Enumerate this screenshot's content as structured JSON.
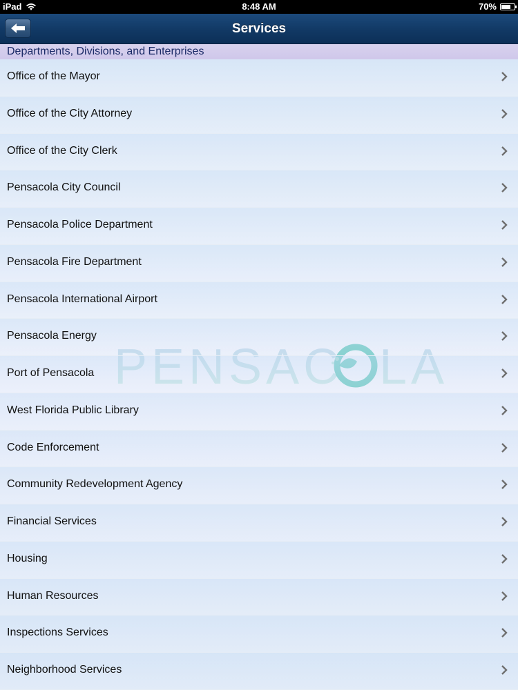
{
  "status_bar": {
    "device": "iPad",
    "time": "8:48 AM",
    "battery": "70%",
    "battery_level": 0.7
  },
  "nav": {
    "title": "Services",
    "back_icon": "back-arrow-icon"
  },
  "section": {
    "header": "Departments, Divisions, and Enterprises"
  },
  "watermark": {
    "text": "PENSACOLA"
  },
  "items": [
    {
      "label": "Office of the Mayor"
    },
    {
      "label": "Office of the City Attorney"
    },
    {
      "label": "Office of the City Clerk"
    },
    {
      "label": "Pensacola City Council"
    },
    {
      "label": "Pensacola Police Department"
    },
    {
      "label": "Pensacola Fire Department"
    },
    {
      "label": "Pensacola International Airport"
    },
    {
      "label": "Pensacola Energy"
    },
    {
      "label": "Port of Pensacola"
    },
    {
      "label": "West Florida Public Library"
    },
    {
      "label": "Code Enforcement"
    },
    {
      "label": "Community Redevelopment Agency"
    },
    {
      "label": "Financial Services"
    },
    {
      "label": "Housing"
    },
    {
      "label": "Human Resources"
    },
    {
      "label": "Inspections Services"
    },
    {
      "label": "Neighborhood Services"
    }
  ],
  "colors": {
    "nav_bar": "#123a66",
    "section_header": "#d3ccec",
    "watermark_blue": "#9fc3df",
    "watermark_teal": "#3bb9b0"
  }
}
